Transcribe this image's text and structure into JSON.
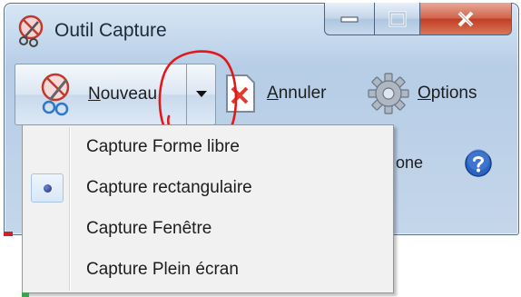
{
  "window": {
    "title": "Outil Capture"
  },
  "toolbar": {
    "nouveau_label_u": "N",
    "nouveau_label_rest": "ouveau",
    "annuler_label_u": "A",
    "annuler_label_rest": "nnuler",
    "options_label_u": "O",
    "options_label_rest": "ptions"
  },
  "partial_text": "one",
  "menu": {
    "items": [
      {
        "label": "Capture Forme libre",
        "selected": false
      },
      {
        "label": "Capture rectangulaire",
        "selected": true
      },
      {
        "label": "Capture Fenêtre",
        "selected": false
      },
      {
        "label": "Capture Plein écran",
        "selected": false
      }
    ]
  },
  "colors": {
    "annotation": "#e0191b",
    "close_button": "#c94a2e",
    "window_frame": "#c3d7ec",
    "menu_background": "#f1f1f1"
  },
  "icons": {
    "app": "scissors-icon",
    "dropdown": "triangle-down-icon",
    "annuler": "cancel-doc-icon",
    "options": "gear-icon",
    "help": "help-icon",
    "selected": "radio-bullet-icon"
  }
}
